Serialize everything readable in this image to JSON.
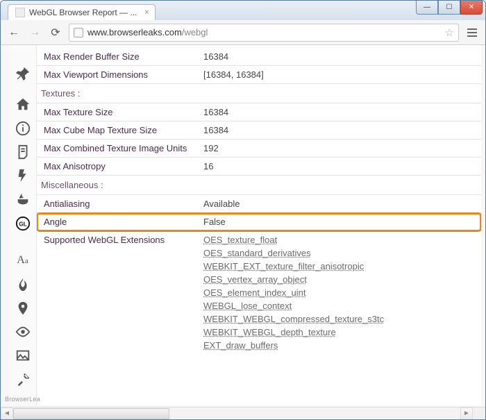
{
  "window": {
    "tab_title": "WebGL Browser Report — ..."
  },
  "omnibox": {
    "url_host": "www.browserleaks.com",
    "url_path": "/webgl"
  },
  "sidebar": {
    "brand": "BrowserLea"
  },
  "sections": {
    "textures": "Textures :",
    "misc": "Miscellaneous :"
  },
  "rows": [
    {
      "k": "Max Render Buffer Size",
      "v": "16384"
    },
    {
      "k": "Max Viewport Dimensions",
      "v": "[16384, 16384]"
    }
  ],
  "texture_rows": [
    {
      "k": "Max Texture Size",
      "v": "16384"
    },
    {
      "k": "Max Cube Map Texture Size",
      "v": "16384"
    },
    {
      "k": "Max Combined Texture Image Units",
      "v": "192"
    },
    {
      "k": "Max Anisotropy",
      "v": "16"
    }
  ],
  "misc_rows": [
    {
      "k": "Antialiasing",
      "v": "Available"
    },
    {
      "k": "Angle",
      "v": "False"
    }
  ],
  "ext_label": "Supported WebGL Extensions",
  "extensions": [
    "OES_texture_float",
    "OES_standard_derivatives",
    "WEBKIT_EXT_texture_filter_anisotropic",
    "OES_vertex_array_object",
    "OES_element_index_uint",
    "WEBGL_lose_context",
    "WEBKIT_WEBGL_compressed_texture_s3tc",
    "WEBKIT_WEBGL_depth_texture",
    "EXT_draw_buffers"
  ]
}
